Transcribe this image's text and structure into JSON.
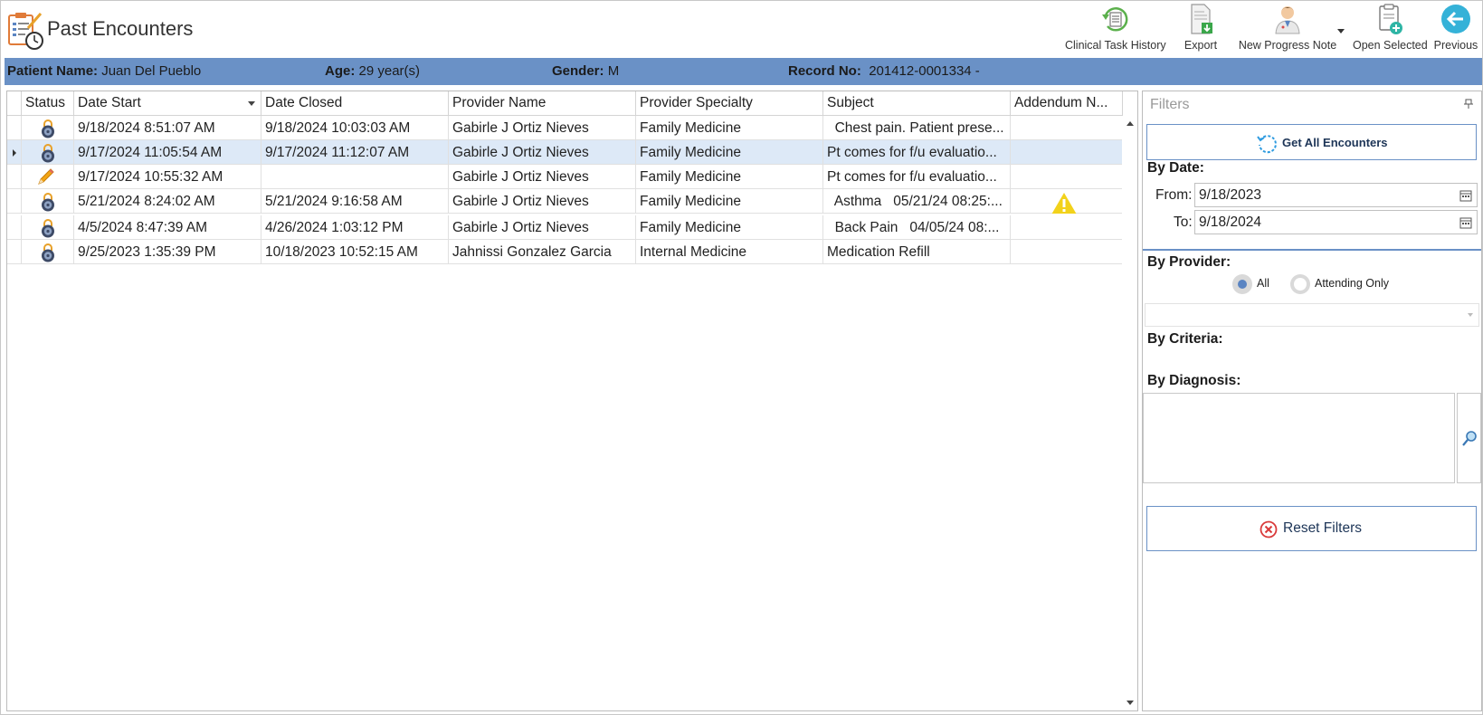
{
  "app": {
    "title": "Past Encounters",
    "logo_icon": "clipboard-clock-icon"
  },
  "toolbar": {
    "clinical_task_history": "Clinical Task History",
    "export": "Export",
    "new_progress_note": "New Progress Note",
    "open_selected": "Open Selected",
    "previous": "Previous"
  },
  "patient": {
    "name_label": "Patient Name:",
    "name": "Juan Del Pueblo",
    "age_label": "Age:",
    "age": "29 year(s)",
    "gender_label": "Gender:",
    "gender": "M",
    "record_label": "Record No:",
    "record": "201412-0001334 -"
  },
  "grid": {
    "columns": [
      "Status",
      "Date Start",
      "Date Closed",
      "Provider Name",
      "Provider Specialty",
      "Subject",
      "Addendum N..."
    ],
    "sorted_column": "Date Start",
    "rows": [
      {
        "status": "locked",
        "date_start": "9/18/2024 8:51:07 AM",
        "date_closed": "9/18/2024 10:03:03 AM",
        "provider": "Gabirle J Ortiz Nieves",
        "specialty": "Family Medicine",
        "subject": "  Chest pain. Patient prese...",
        "addendum": "",
        "selected": false
      },
      {
        "status": "locked",
        "date_start": "9/17/2024 11:05:54 AM",
        "date_closed": "9/17/2024 11:12:07 AM",
        "provider": "Gabirle J Ortiz Nieves",
        "specialty": "Family Medicine",
        "subject": "Pt comes for f/u evaluatio...",
        "addendum": "",
        "selected": true
      },
      {
        "status": "editing",
        "date_start": "9/17/2024 10:55:32 AM",
        "date_closed": "",
        "provider": "Gabirle J Ortiz Nieves",
        "specialty": "Family Medicine",
        "subject": "Pt comes for f/u evaluatio...",
        "addendum": "",
        "selected": false
      },
      {
        "status": "locked",
        "date_start": "5/21/2024 8:24:02 AM",
        "date_closed": "5/21/2024 9:16:58 AM",
        "provider": "Gabirle J Ortiz Nieves",
        "specialty": "Family Medicine",
        "subject": "  Asthma   05/21/24 08:25:...",
        "addendum": "warning",
        "selected": false
      },
      {
        "status": "locked",
        "date_start": "4/5/2024 8:47:39 AM",
        "date_closed": "4/26/2024 1:03:12 PM",
        "provider": "Gabirle J Ortiz Nieves",
        "specialty": "Family Medicine",
        "subject": "  Back Pain   04/05/24 08:...",
        "addendum": "",
        "selected": false
      },
      {
        "status": "locked",
        "date_start": "9/25/2023 1:35:39 PM",
        "date_closed": "10/18/2023 10:52:15 AM",
        "provider": "Jahnissi Gonzalez Garcia",
        "specialty": "Internal Medicine",
        "subject": "Medication Refill",
        "addendum": "",
        "selected": false
      }
    ]
  },
  "filters": {
    "title": "Filters",
    "get_all": "Get All Encounters",
    "by_date": "By Date:",
    "from_label": "From:",
    "from_value": "9/18/2023",
    "to_label": "To:",
    "to_value": "9/18/2024",
    "by_provider": "By Provider:",
    "radio_all": "All",
    "radio_attending": "Attending Only",
    "selected_radio": "All",
    "by_criteria": "By Criteria:",
    "by_diagnosis": "By Diagnosis:",
    "reset": "Reset Filters"
  },
  "colors": {
    "accent": "#6a91c6",
    "selected_row": "#dde9f7",
    "warning": "#f2d21b",
    "reset_icon": "#d93a3a",
    "refresh_icon": "#2e9be0"
  }
}
